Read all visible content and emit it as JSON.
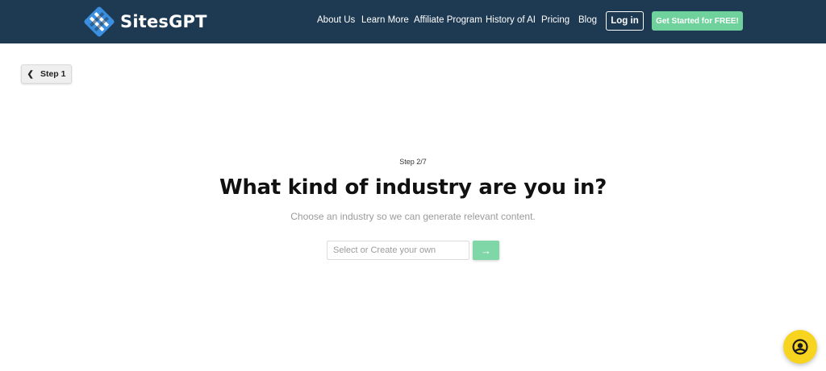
{
  "brand": {
    "name": "SitesGPT"
  },
  "nav": {
    "links": [
      "About Us",
      "Learn More",
      "Affiliate Program",
      "History of AI",
      "Pricing",
      "Blog"
    ],
    "login_label": "Log in",
    "cta_label": "Get Started for FREE!"
  },
  "back": {
    "label": "Step 1",
    "icon": "chevron-left-icon"
  },
  "wizard": {
    "step": "Step 2/7",
    "title": "What kind of industry are you in?",
    "subtitle": "Choose an industry so we can generate relevant content.",
    "input_placeholder": "Select or Create your own",
    "input_value": "",
    "submit_icon": "arrow-right-icon"
  },
  "chat_widget": {
    "icon": "chat-bot-icon"
  },
  "colors": {
    "nav_bg": "#1e3a52",
    "accent_green": "#6fd19c",
    "chat_yellow": "#f6d41f"
  }
}
